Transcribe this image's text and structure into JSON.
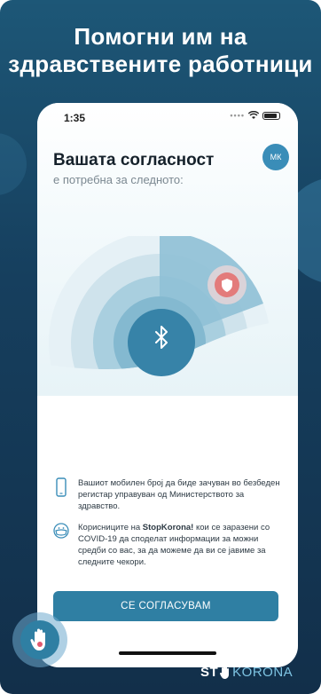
{
  "headline": {
    "line1": "Помогни им на",
    "line2": "здравствените работници"
  },
  "status_bar": {
    "time": "1:35"
  },
  "language_button": {
    "label": "МК"
  },
  "consent": {
    "title": "Вашата согласност",
    "subtitle": "е потребна за следното:"
  },
  "items": [
    {
      "icon": "phone-icon",
      "text": "Вашиот мобилен број да биде зачуван во безбеден регистар управуван од Министерството за здравство."
    },
    {
      "icon": "mask-face-icon",
      "text_pre": "Корисниците на ",
      "text_bold": "StopKorona!",
      "text_post": " кои се заразени со COVID-19 да споделат информации за можни средби со вас, за да можеме да ви се јавиме за следните чекори."
    }
  ],
  "cta": {
    "label": "СЕ СОГЛАСУВАМ"
  },
  "brand": {
    "stop": "ST",
    "p": "P",
    "korona": "KORONA"
  },
  "colors": {
    "accent": "#2f7fa3",
    "background": "#163f5e",
    "shield": "#e37b7b"
  }
}
